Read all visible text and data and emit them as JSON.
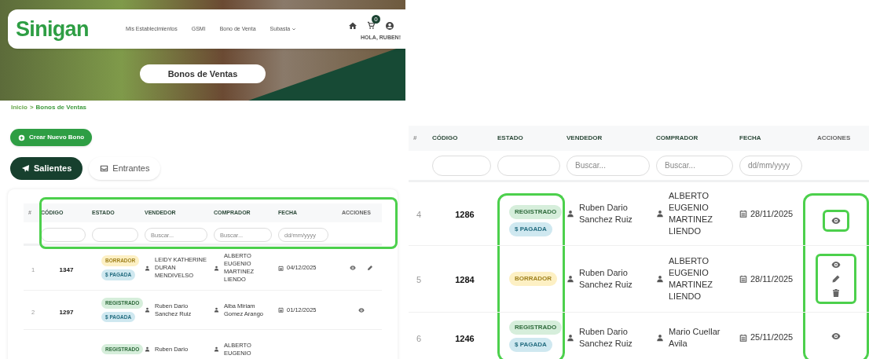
{
  "left_panel": {
    "navbar": {
      "logo": "Sinigan",
      "links": [
        {
          "label": "Mis Establecimientos",
          "dropdown": false
        },
        {
          "label": "GSMI",
          "dropdown": false
        },
        {
          "label": "Bono de Venta",
          "dropdown": false
        },
        {
          "label": "Subasta",
          "dropdown": true
        }
      ],
      "cart_count": "0",
      "greeting": "HOLA, RUBEN!"
    },
    "page_title": "Bonos de Ventas",
    "breadcrumb": {
      "items": [
        "Inicio",
        "Bonos de Ventas"
      ],
      "separator": ">"
    },
    "create_button": "Crear Nuevo Bono",
    "tabs": [
      {
        "label": "Salientes",
        "kind": "sent",
        "selected": true
      },
      {
        "label": "Entrantes",
        "kind": "inbox",
        "selected": false
      }
    ],
    "table": {
      "header_highlighted": true,
      "columns": [
        "#",
        "CÓDIGO",
        "ESTADO",
        "VENDEDOR",
        "COMPRADOR",
        "FECHA",
        "ACCIONES"
      ],
      "filters": [
        {
          "kind": "text"
        },
        {
          "kind": "text"
        },
        {
          "kind": "text",
          "placeholder": "Buscar..."
        },
        {
          "kind": "text",
          "placeholder": "Buscar..."
        },
        {
          "kind": "date",
          "placeholder": "dd/mm/yyyy"
        }
      ],
      "rows": [
        {
          "number": "1",
          "code": "1347",
          "badges": [
            {
              "label": "BORRADOR",
              "kind": "draft"
            },
            {
              "label": "$ PAGADA",
              "kind": "paid"
            }
          ],
          "status_highlighted": false,
          "seller": "LEIDY KATHERINE DURAN MENDIVELSO",
          "buyer": "ALBERTO EUGENIO MARTINEZ LIENDO",
          "date": "04/12/2025",
          "actions": [
            {
              "kind": "view"
            },
            {
              "kind": "edit"
            }
          ],
          "actions_column_highlighted": false,
          "actions_highlighted": false
        },
        {
          "number": "2",
          "code": "1297",
          "badges": [
            {
              "label": "REGISTRADO",
              "kind": "registered"
            },
            {
              "label": "$ PAGADA",
              "kind": "paid"
            }
          ],
          "status_highlighted": false,
          "seller": "Ruben Dario Sanchez Ruiz",
          "buyer": "Alba Miriam Gomez Arango",
          "date": "01/12/2025",
          "actions": [
            {
              "kind": "view"
            }
          ],
          "actions_column_highlighted": false,
          "actions_highlighted": false
        },
        {
          "badges": [
            {
              "label": "REGISTRADO",
              "kind": "registered"
            }
          ],
          "status_highlighted": false,
          "seller": "Ruben Dario",
          "buyer": "ALBERTO EUGENIO",
          "actions": []
        }
      ]
    }
  },
  "right_panel": {
    "table": {
      "header_highlighted": false,
      "columns": [
        "#",
        "CÓDIGO",
        "ESTADO",
        "VENDEDOR",
        "COMPRADOR",
        "FECHA",
        "ACCIONES"
      ],
      "filters": [
        {
          "kind": "text"
        },
        {
          "kind": "text"
        },
        {
          "kind": "text",
          "placeholder": "Buscar..."
        },
        {
          "kind": "text",
          "placeholder": "Buscar..."
        },
        {
          "kind": "date",
          "placeholder": "dd/mm/yyyy"
        }
      ],
      "rows": [
        {
          "number": "4",
          "code": "1286",
          "badges": [
            {
              "label": "REGISTRADO",
              "kind": "registered"
            },
            {
              "label": "$ PAGADA",
              "kind": "paid"
            }
          ],
          "status_highlighted": true,
          "seller": "Ruben Dario Sanchez Ruiz",
          "buyer": "ALBERTO EUGENIO MARTINEZ LIENDO",
          "date": "28/11/2025",
          "actions": [
            {
              "kind": "view"
            }
          ],
          "actions_column_highlighted": true,
          "actions_highlighted": true
        },
        {
          "number": "5",
          "code": "1284",
          "badges": [
            {
              "label": "BORRADOR",
              "kind": "draft"
            }
          ],
          "status_highlighted": true,
          "seller": "Ruben Dario Sanchez Ruiz",
          "buyer": "ALBERTO EUGENIO MARTINEZ LIENDO",
          "date": "28/11/2025",
          "actions": [
            {
              "kind": "view"
            },
            {
              "kind": "edit"
            },
            {
              "kind": "delete"
            }
          ],
          "actions_column_highlighted": true,
          "actions_highlighted": true
        },
        {
          "number": "6",
          "code": "1246",
          "badges": [
            {
              "label": "REGISTRADO",
              "kind": "registered"
            },
            {
              "label": "$ PAGADA",
              "kind": "paid"
            }
          ],
          "status_highlighted": true,
          "seller": "Ruben Dario Sanchez Ruiz",
          "buyer": "Mario Cuellar Avila",
          "date": "25/11/2025",
          "actions": [
            {
              "kind": "view"
            }
          ],
          "actions_column_highlighted": true,
          "actions_highlighted": false
        }
      ]
    }
  }
}
